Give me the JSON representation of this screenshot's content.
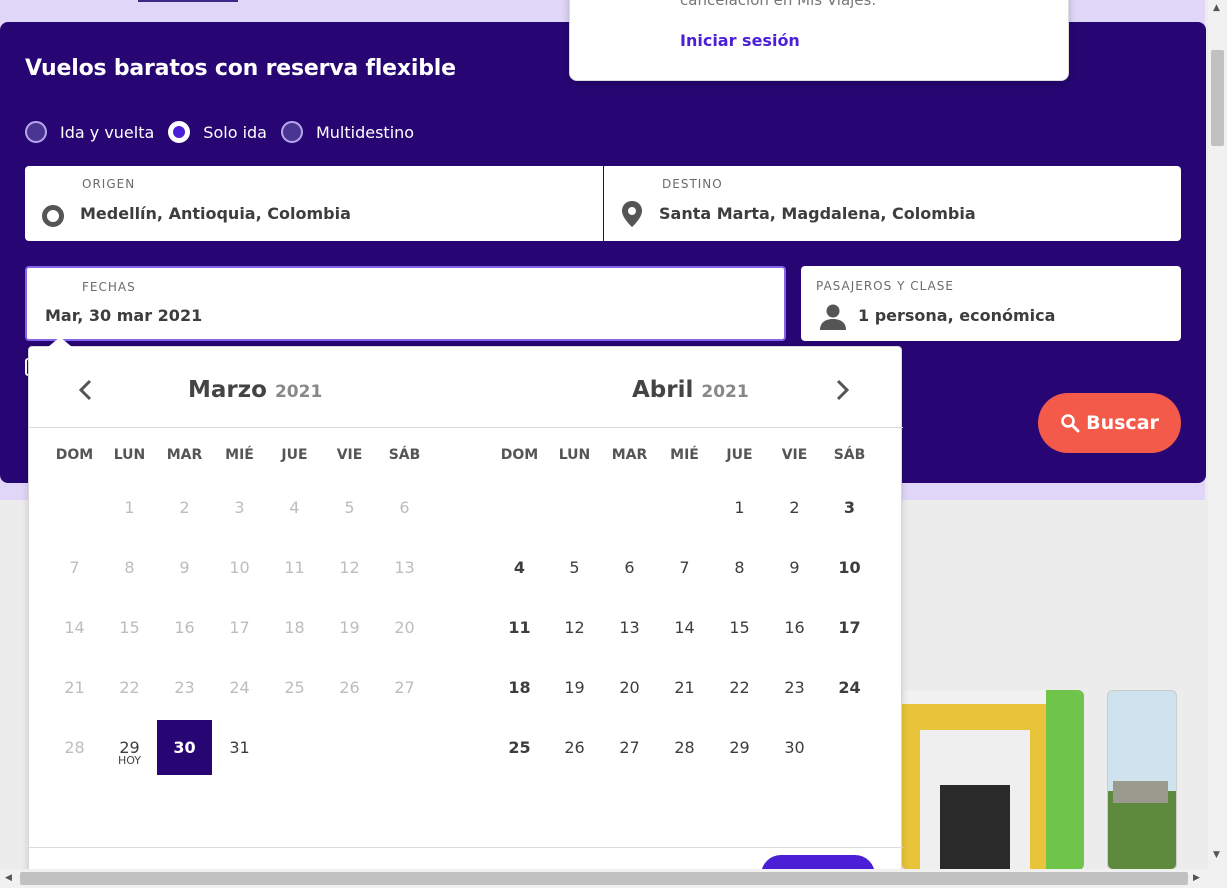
{
  "header": {
    "title": "Vuelos baratos con reserva flexible"
  },
  "trip_type": {
    "options": [
      "Ida y vuelta",
      "Solo ida",
      "Multidestino"
    ],
    "selected": "Solo ida"
  },
  "origin": {
    "label": "ORIGEN",
    "value": "Medellín, Antioquia, Colombia"
  },
  "destination": {
    "label": "DESTINO",
    "value": "Santa Marta, Magdalena, Colombia"
  },
  "dates": {
    "label": "FECHAS",
    "value": "Mar, 30 mar 2021"
  },
  "passengers": {
    "label": "PASAJEROS Y CLASE",
    "value": "1 persona, económica"
  },
  "search_button": {
    "label": "Buscar"
  },
  "account_dropdown": {
    "message": "cancelación en Mis Viajes.",
    "login_label": "Iniciar sesión"
  },
  "calendar": {
    "weekdays": [
      "DOM",
      "LUN",
      "MAR",
      "MIÉ",
      "JUE",
      "VIE",
      "SÁB"
    ],
    "months": [
      {
        "name": "Marzo",
        "year": "2021",
        "first_weekday": 1,
        "days": 31,
        "past_until": 28,
        "today": 29,
        "today_label": "HOY",
        "selected": 30
      },
      {
        "name": "Abril",
        "year": "2021",
        "first_weekday": 4,
        "days": 30
      }
    ]
  },
  "colors": {
    "hero_bg": "#270673",
    "accent": "#4b1fd6",
    "search_btn": "#f35a49",
    "selected_day": "#270673"
  }
}
